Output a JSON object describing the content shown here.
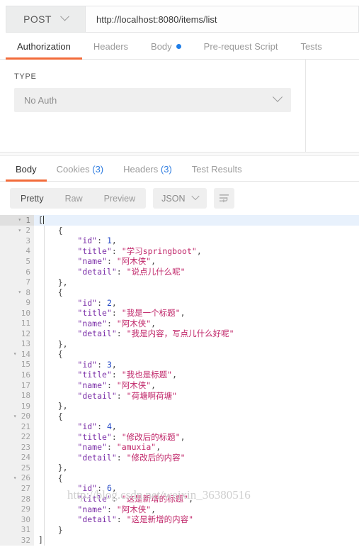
{
  "request": {
    "method": "POST",
    "url": "http://localhost:8080/items/list",
    "tabs": [
      {
        "label": "Authorization",
        "active": true,
        "dot": false
      },
      {
        "label": "Headers",
        "active": false,
        "dot": false
      },
      {
        "label": "Body",
        "active": false,
        "dot": true
      },
      {
        "label": "Pre-request Script",
        "active": false,
        "dot": false
      },
      {
        "label": "Tests",
        "active": false,
        "dot": false
      }
    ]
  },
  "auth": {
    "type_label": "TYPE",
    "selected": "No Auth"
  },
  "response": {
    "tabs": [
      {
        "label": "Body",
        "count": "",
        "active": true
      },
      {
        "label": "Cookies",
        "count": "(3)",
        "active": false
      },
      {
        "label": "Headers",
        "count": "(3)",
        "active": false
      },
      {
        "label": "Test Results",
        "count": "",
        "active": false
      }
    ],
    "viewer": {
      "modes": [
        {
          "label": "Pretty",
          "active": true
        },
        {
          "label": "Raw",
          "active": false
        },
        {
          "label": "Preview",
          "active": false
        }
      ],
      "format": "JSON",
      "wrap_icon": "word-wrap-icon"
    }
  },
  "watermark": "http://blog.csdn.net/weixin_36380516",
  "body_items": [
    {
      "id": 1,
      "title": "学习springboot",
      "name": "阿木侠",
      "detail": "说点儿什么呢"
    },
    {
      "id": 2,
      "title": "我是一个标题",
      "name": "阿木侠",
      "detail": "我是内容，写点儿什么好呢"
    },
    {
      "id": 3,
      "title": "我也是标题",
      "name": "阿木侠",
      "detail": "荷塘啊荷塘"
    },
    {
      "id": 4,
      "title": "修改后的标题",
      "name": "amuxia",
      "detail": "修改后的内容"
    },
    {
      "id": 6,
      "title": "这是新增的标题",
      "name": "阿木侠",
      "detail": "这是新增的内容"
    }
  ],
  "colors": {
    "accent": "#f26b3a",
    "link": "#2f7de0",
    "key": "#7b2fa8",
    "string": "#c02669",
    "number": "#1f45c4",
    "highlight": "#e8f1fc"
  }
}
